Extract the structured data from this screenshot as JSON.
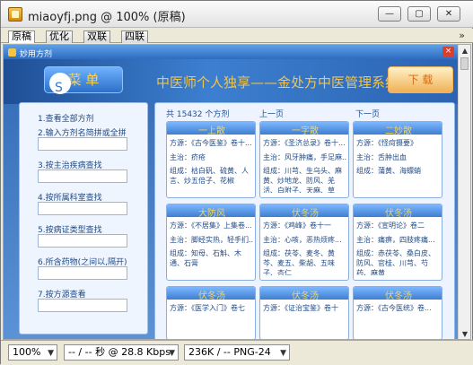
{
  "window": {
    "title": "miaoyfj.png @ 100% (原稿)",
    "controls": [
      "—",
      "▢",
      "✕"
    ]
  },
  "tabs": [
    "原稿",
    "优化",
    "双联",
    "四联"
  ],
  "more": "»",
  "app": {
    "title": "妙用方剂",
    "menu_label": "菜 单",
    "banner_title": "中医师个人独享——金处方中医管理系统",
    "download_label": "下 载"
  },
  "left_menu": [
    {
      "label": "1.查看全部方剂"
    },
    {
      "label": "2.输入方剂名简拼或全拼",
      "placeholder": ""
    },
    {
      "label": "3.按主治疾病查找",
      "placeholder": ""
    },
    {
      "label": "4.按所属科室查找",
      "placeholder": ""
    },
    {
      "label": "5.按病证类型查找",
      "placeholder": ""
    },
    {
      "label": "6.所含药物(之间以,隔开)",
      "placeholder": ""
    },
    {
      "label": "7.按方源查看",
      "placeholder": ""
    }
  ],
  "list": {
    "total": "共 15432 个方剂",
    "prev": "上一页",
    "next": "下一页"
  },
  "cards": [
    {
      "name": "一上散",
      "source": "方源：《古今医鉴》卷十...",
      "indication": "主治：疥疮",
      "composition": "组成：枯白矾、硫黄、人言、炒五倍子、花椒"
    },
    {
      "name": "一字散",
      "source": "方源：《圣济总录》卷十...",
      "indication": "主治：风牙肿痛，手足麻...",
      "composition": "组成：川芎、生乌头、麻黄、炒地龙、防风、羌活、白附子、天麻、草乌..."
    },
    {
      "name": "二妙散",
      "source": "方源：《怪疴摄要》",
      "indication": "主治：舌肿出血",
      "composition": "组成：蒲黄、海螵蛸"
    },
    {
      "name": "大防风",
      "source": "方源：《不居集》上集卷...",
      "indication": "主治：脚经实热，轻手扪...",
      "composition": "组成：知母、石斛、木通、石膏"
    },
    {
      "name": "伏冬汤",
      "source": "方源：《鸡峰》卷十一",
      "indication": "主治：心咳，恶热烦疼...",
      "composition": "组成：茯苓、麦冬、黄芩、麦五、柴胡、五味子、杏仁"
    },
    {
      "name": "伏冬汤",
      "source": "方源：《宣明论》卷二",
      "indication": "主治：痛痹，四肢疼痛...",
      "composition": "组成：赤茯苓、桑白皮、防风、官桂、川芎、芍药、麻黄"
    },
    {
      "name": "伏冬汤",
      "source": "方源：《医学入门》卷七"
    },
    {
      "name": "伏冬汤",
      "source": "方源：《证治宝鉴》卷十"
    },
    {
      "name": "伏冬汤",
      "source": "方源：《古今医统》卷..."
    }
  ],
  "statusbar": {
    "zoom": "100%",
    "speed": "-- / -- 秒 @ 28.8 Kbps",
    "format": "236K / -- PNG-24"
  }
}
